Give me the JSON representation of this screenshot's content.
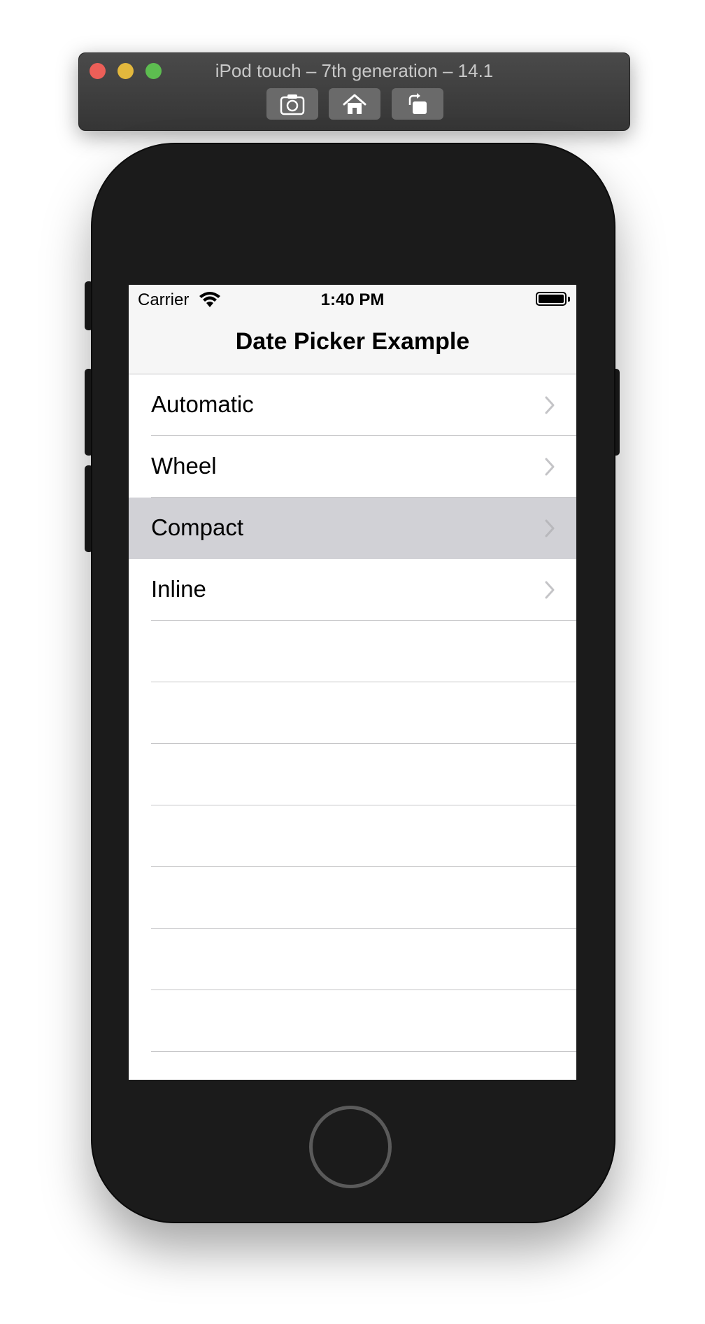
{
  "simulator": {
    "title": "iPod touch – 7th generation – 14.1",
    "toolbar": [
      {
        "icon": "screenshot-icon"
      },
      {
        "icon": "home-icon"
      },
      {
        "icon": "rotate-icon"
      }
    ]
  },
  "status_bar": {
    "carrier": "Carrier",
    "time": "1:40 PM"
  },
  "nav": {
    "title": "Date Picker Example"
  },
  "list": {
    "items": [
      {
        "label": "Automatic",
        "selected": false
      },
      {
        "label": "Wheel",
        "selected": false
      },
      {
        "label": "Compact",
        "selected": true
      },
      {
        "label": "Inline",
        "selected": false
      }
    ]
  },
  "colors": {
    "selected_row": "#d1d1d6",
    "separator": "#c6c6c8",
    "chevron": "#c4c4c7"
  }
}
